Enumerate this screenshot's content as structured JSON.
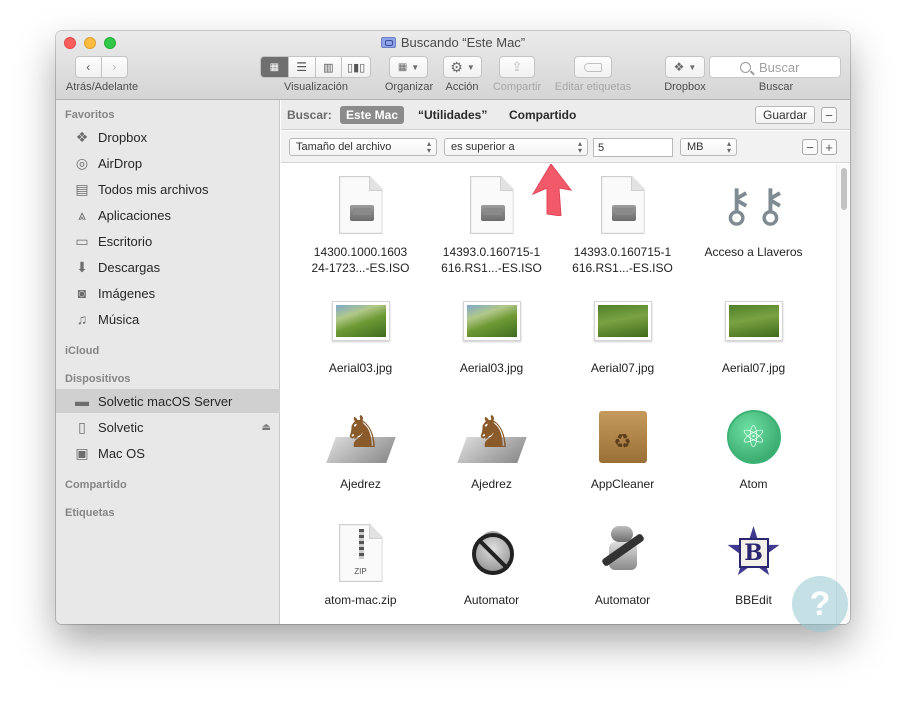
{
  "window": {
    "title": "Buscando “Este Mac”"
  },
  "toolbar": {
    "nav_label": "Atrás/Adelante",
    "view_label": "Visualización",
    "organize_label": "Organizar",
    "action_label": "Acción",
    "share_label": "Compartir",
    "tags_label": "Editar etiquetas",
    "dropbox_label": "Dropbox",
    "search_label": "Buscar",
    "search_placeholder": "Buscar"
  },
  "sidebar": {
    "favorites_header": "Favoritos",
    "favorites": [
      {
        "label": "Dropbox",
        "icon": "dropbox-icon"
      },
      {
        "label": "AirDrop",
        "icon": "airdrop-icon"
      },
      {
        "label": "Todos mis archivos",
        "icon": "all-files-icon"
      },
      {
        "label": "Aplicaciones",
        "icon": "applications-icon"
      },
      {
        "label": "Escritorio",
        "icon": "desktop-icon"
      },
      {
        "label": "Descargas",
        "icon": "downloads-icon"
      },
      {
        "label": "Imágenes",
        "icon": "pictures-icon"
      },
      {
        "label": "Música",
        "icon": "music-icon"
      }
    ],
    "icloud_header": "iCloud",
    "devices_header": "Dispositivos",
    "devices": [
      {
        "label": "Solvetic macOS Server",
        "icon": "laptop-icon",
        "selected": true
      },
      {
        "label": "Solvetic",
        "icon": "disk-icon",
        "eject": true
      },
      {
        "label": "Mac OS",
        "icon": "hard-drive-icon"
      }
    ],
    "shared_header": "Compartido",
    "tags_header": "Etiquetas"
  },
  "scope": {
    "label": "Buscar:",
    "options": [
      "Este Mac",
      "“Utilidades”",
      "Compartido"
    ],
    "active": "Este Mac",
    "save_label": "Guardar"
  },
  "criteria": {
    "attribute": "Tamaño del archivo",
    "operator": "es superior a",
    "value": "5",
    "unit": "MB"
  },
  "files": [
    {
      "name1": "14300.1000.1603",
      "name2": "24-1723...-ES.ISO",
      "icon": "iso-disk-icon"
    },
    {
      "name1": "14393.0.160715-1",
      "name2": "616.RS1...-ES.ISO",
      "icon": "iso-disk-icon"
    },
    {
      "name1": "14393.0.160715-1",
      "name2": "616.RS1...-ES.ISO",
      "icon": "iso-disk-icon"
    },
    {
      "name1": "Acceso a Llaveros",
      "name2": "",
      "icon": "keychain-icon"
    },
    {
      "name1": "Aerial03.jpg",
      "name2": "",
      "icon": "image-thumbnail-icon"
    },
    {
      "name1": "Aerial03.jpg",
      "name2": "",
      "icon": "image-thumbnail-icon"
    },
    {
      "name1": "Aerial07.jpg",
      "name2": "",
      "icon": "image-thumbnail-icon"
    },
    {
      "name1": "Aerial07.jpg",
      "name2": "",
      "icon": "image-thumbnail-icon"
    },
    {
      "name1": "Ajedrez",
      "name2": "",
      "icon": "chess-icon"
    },
    {
      "name1": "Ajedrez",
      "name2": "",
      "icon": "chess-icon"
    },
    {
      "name1": "AppCleaner",
      "name2": "",
      "icon": "appcleaner-icon"
    },
    {
      "name1": "Atom",
      "name2": "",
      "icon": "atom-icon"
    },
    {
      "name1": "atom-mac.zip",
      "name2": "",
      "icon": "zip-icon"
    },
    {
      "name1": "Automator",
      "name2": "",
      "icon": "automator-disabled-icon"
    },
    {
      "name1": "Automator",
      "name2": "",
      "icon": "automator-icon"
    },
    {
      "name1": "BBEdit",
      "name2": "",
      "icon": "bbedit-icon"
    }
  ],
  "colors": {
    "annotation_arrow": "#f25a6a",
    "selection": "#d0d0d0",
    "sidebar_bg": "#e8e8e8"
  }
}
